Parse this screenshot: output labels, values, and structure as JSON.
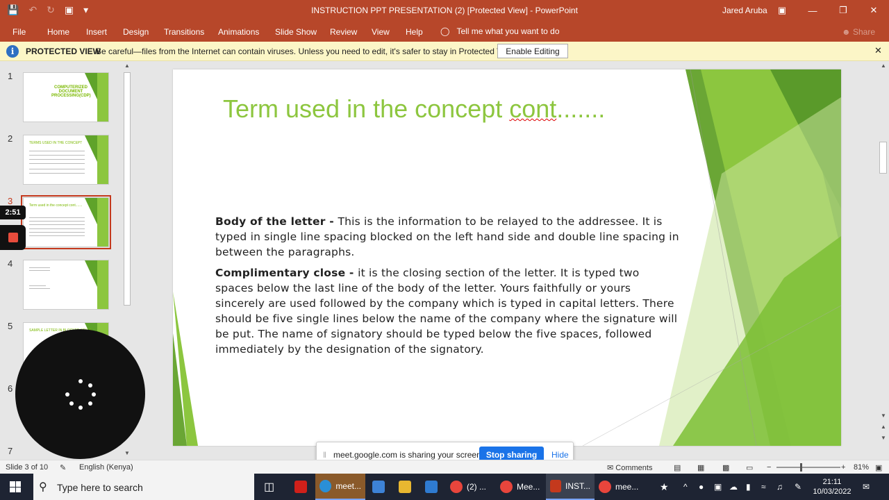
{
  "window": {
    "title": "INSTRUCTION PPT PRESENTATION (2) [Protected View]  -  PowerPoint",
    "user": "Jared Aruba"
  },
  "ribbon": {
    "tabs": [
      "File",
      "Home",
      "Insert",
      "Design",
      "Transitions",
      "Animations",
      "Slide Show",
      "Review",
      "View",
      "Help"
    ],
    "tell_me": "Tell me what you want to do",
    "share": "Share"
  },
  "protected": {
    "label": "PROTECTED VIEW",
    "message": "Be careful—files from the Internet can contain viruses. Unless you need to edit, it's safer to stay in Protected View.",
    "button": "Enable Editing"
  },
  "thumbnails": [
    {
      "num": "1",
      "title": "COMPUTERIZED DOCUMENT PROCESSING(CDP)"
    },
    {
      "num": "2",
      "title": "TERMS USED IN THE CONCEPT"
    },
    {
      "num": "3",
      "title": "Term used in the concept cont......."
    },
    {
      "num": "4",
      "title": ""
    },
    {
      "num": "5",
      "title": "SAMPLE LETTER IN BLOCKED STYLE"
    },
    {
      "num": "6",
      "title": ""
    },
    {
      "num": "7",
      "title": ""
    }
  ],
  "recording": {
    "timer": "2:51"
  },
  "slide": {
    "title_main": "Term used in the concept ",
    "title_squiggle": "cont",
    "title_tail": ".......",
    "p1_bold": "Body of the letter - ",
    "p1_text": "This is the information to be relayed to the addressee.  It is typed in single line spacing blocked on the left hand side and double line spacing in between the paragraphs.",
    "p2_bold": "Complimentary close - ",
    "p2_text": "it is the closing section of the letter. It is typed two spaces below the last line of the body of the letter. Yours faithfully or yours sincerely are used followed by the company which is typed in capital letters. There should be five single lines below the name of the company where the signature will be put.  The name of signatory should be typed below the five spaces, followed immediately by the designation of the signatory."
  },
  "share_bar": {
    "message_domain": "meet.google.com",
    "message_rest": " is sharing your screen.",
    "stop": "Stop sharing",
    "hide": "Hide"
  },
  "status": {
    "slide": "Slide 3 of 10",
    "language": "English (Kenya)",
    "comments": "Comments",
    "zoom": "81%",
    "zoom_level": 0.81
  },
  "taskbar": {
    "search_placeholder": "Type here to search",
    "items": [
      "meet...",
      "(2) ...",
      "Mee...",
      "INST...",
      "mee..."
    ],
    "time": "21:11",
    "date": "10/03/2022"
  },
  "colors": {
    "accent": "#b7472a",
    "slide_green": "#8dc63f",
    "dark_green": "#5fa32a"
  }
}
